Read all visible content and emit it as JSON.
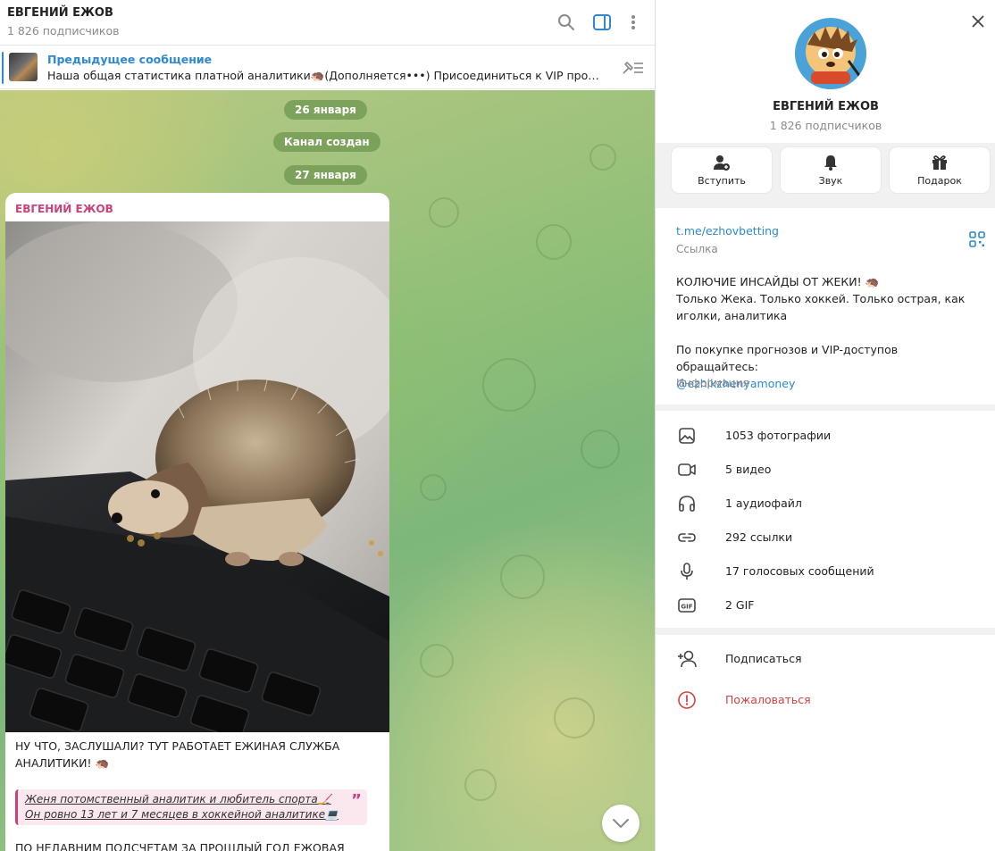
{
  "chat": {
    "title": "ЕВГЕНИЙ ЕЖОВ",
    "subscribers": "1 826 подписчиков",
    "pinned": {
      "title": "Предыдущее сообщение",
      "text": "Наша общая статистика платной аналитики🦔(Дополняется•••)  Присоединиться к VIP продуктам..."
    },
    "dates": [
      "26 января",
      "Канал создан",
      "27 января"
    ],
    "message": {
      "author": "ЕВГЕНИЙ ЕЖОВ",
      "body": "НУ ЧТО, ЗАСЛУШАЛИ? ТУТ РАБОТАЕТ ЕЖИНАЯ СЛУЖБА АНАЛИТИКИ! 🦔",
      "quote_line1": "Женя потомственный аналитик и любитель спорта🏒",
      "quote_line2": "Он ровно 13 лет и 7 месяцев в хоккейной аналитике💻",
      "quote_mark": "”",
      "more": "ПО НЕДАВНИМ ПОДСЧЕТАМ ЗА ПРОШЛЫЙ ГОД ЕЖОВАЯ"
    }
  },
  "panel": {
    "name": "ЕВГЕНИЙ ЕЖОВ",
    "subscribers": "1 826 подписчиков",
    "buttons": [
      {
        "label": "Вступить",
        "icon": "add-user-icon"
      },
      {
        "label": "Звук",
        "icon": "bell-icon"
      },
      {
        "label": "Подарок",
        "icon": "gift-icon"
      }
    ],
    "link": "t.me/ezhovbetting",
    "link_caption": "Ссылка",
    "description": "КОЛЮЧИЕ ИНСАЙДЫ ОТ ЖЕКИ! 🦔\nТолько Жека. Только хоккей. Только острая, как иголки, аналитика\n\nПо покупке прогнозов и VIP-доступов обращайтесь:",
    "contact": "@ezhikzhenyamoney",
    "info_caption": "Информация",
    "media": [
      {
        "label": "1053 фотографии",
        "icon": "photo-icon"
      },
      {
        "label": "5 видео",
        "icon": "video-icon"
      },
      {
        "label": "1 аудиофайл",
        "icon": "headphones-icon"
      },
      {
        "label": "292 ссылки",
        "icon": "link-icon"
      },
      {
        "label": "17 голосовых сообщений",
        "icon": "microphone-icon"
      },
      {
        "label": "2 GIF",
        "icon": "gif-icon"
      }
    ],
    "gif_badge": "GIF",
    "actions": [
      {
        "label": "Подписаться",
        "icon": "subscribe-icon"
      },
      {
        "label": "Пожаловаться",
        "icon": "report-icon"
      }
    ],
    "colors": {
      "accent": "#2f89d1",
      "author": "#c9427c",
      "danger": "#d4423f"
    }
  }
}
